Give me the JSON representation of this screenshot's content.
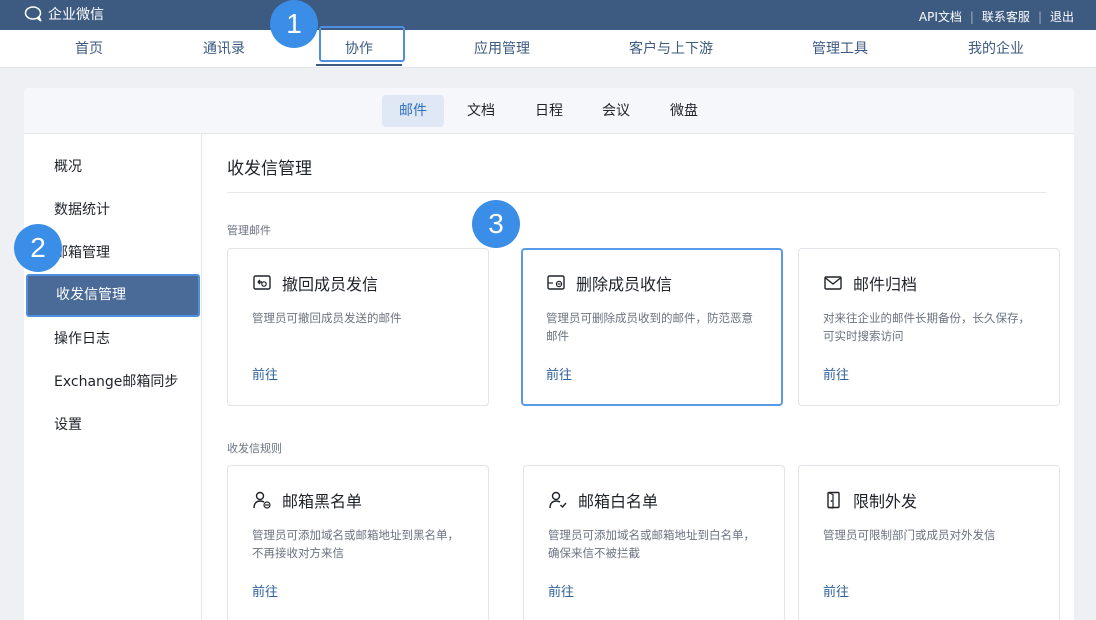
{
  "topbar": {
    "app_name": "企业微信",
    "links": [
      "API文档",
      "联系客服",
      "退出"
    ]
  },
  "main_nav": [
    {
      "label": "首页"
    },
    {
      "label": "通讯录"
    },
    {
      "label": "协作",
      "active": true
    },
    {
      "label": "应用管理"
    },
    {
      "label": "客户与上下游"
    },
    {
      "label": "管理工具"
    },
    {
      "label": "我的企业"
    }
  ],
  "sub_tabs": [
    {
      "label": "邮件",
      "active": true
    },
    {
      "label": "文档"
    },
    {
      "label": "日程"
    },
    {
      "label": "会议"
    },
    {
      "label": "微盘"
    }
  ],
  "sidebar": [
    {
      "label": "概况"
    },
    {
      "label": "数据统计"
    },
    {
      "label": "邮箱管理"
    },
    {
      "label": "收发信管理",
      "active": true
    },
    {
      "label": "操作日志"
    },
    {
      "label": "Exchange邮箱同步"
    },
    {
      "label": "设置"
    }
  ],
  "page": {
    "title": "收发信管理",
    "sections": [
      {
        "label": "管理邮件",
        "cards": [
          {
            "icon": "recall-mail-icon",
            "title": "撤回成员发信",
            "desc": "管理员可撤回成员发送的邮件",
            "action": "前往"
          },
          {
            "icon": "delete-mail-icon",
            "title": "删除成员收信",
            "desc": "管理员可删除成员收到的邮件，防范恶意邮件",
            "action": "前往",
            "highlight": true
          },
          {
            "icon": "mail-archive-icon",
            "title": "邮件归档",
            "desc": "对来往企业的邮件长期备份，长久保存，可实时搜索访问",
            "action": "前往"
          }
        ]
      },
      {
        "label": "收发信规则",
        "cards": [
          {
            "icon": "blacklist-user-icon",
            "title": "邮箱黑名单",
            "desc": "管理员可添加域名或邮箱地址到黑名单，不再接收对方来信",
            "action": "前往"
          },
          {
            "icon": "whitelist-user-icon",
            "title": "邮箱白名单",
            "desc": "管理员可添加域名或邮箱地址到白名单，确保来信不被拦截",
            "action": "前往"
          },
          {
            "icon": "restrict-send-icon",
            "title": "限制外发",
            "desc": "管理员可限制部门或成员对外发信",
            "action": "前往"
          }
        ]
      }
    ]
  },
  "callouts": [
    "1",
    "2",
    "3"
  ],
  "colors": {
    "topbar": "#3d5a80",
    "accent": "#3a8ee8",
    "active_sidebar": "#4a6a98",
    "link": "#2d5f9a"
  }
}
